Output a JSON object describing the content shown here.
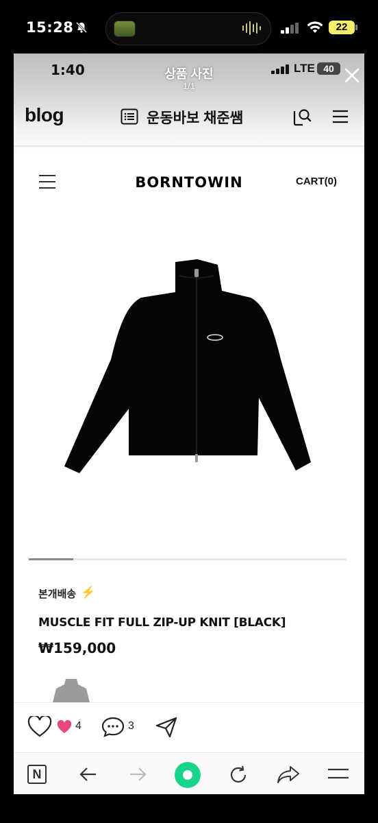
{
  "status_bar": {
    "time": "15:28",
    "battery": "22"
  },
  "photo_viewer": {
    "title": "상품 사진",
    "count": "1/1",
    "inner_status": {
      "time": "1:40",
      "network": "LTE",
      "battery": "40"
    }
  },
  "blog_header": {
    "logo": "blog",
    "blog_name": "운동바보 채준쌤"
  },
  "shop": {
    "brand": "BORNTOWIN",
    "cart": "CART(0)",
    "shipping": "본개배송",
    "product_name": "MUSCLE FIT FULL ZIP-UP KNIT [BLACK]",
    "price": "₩159,000",
    "gallery_progress": 0.14
  },
  "reactions": {
    "likes": "4",
    "comments": "3"
  },
  "browser_bar": {
    "n_label": "N"
  },
  "colors": {
    "battery_yellow": "#f2ee6a",
    "like_pink": "#e8477a",
    "home_green": "#19d48b",
    "bolt_yellow": "#e8c62a"
  },
  "icons": [
    "bell-muted-icon",
    "signal-icon",
    "wifi-icon",
    "close-icon",
    "list-icon",
    "search-icon",
    "menu-icon",
    "hamburger-icon",
    "heart-outline-icon",
    "heart-filled-icon",
    "comment-icon",
    "send-icon",
    "back-arrow-icon",
    "forward-arrow-icon",
    "home-dot-icon",
    "reload-icon",
    "share-arrow-icon"
  ]
}
